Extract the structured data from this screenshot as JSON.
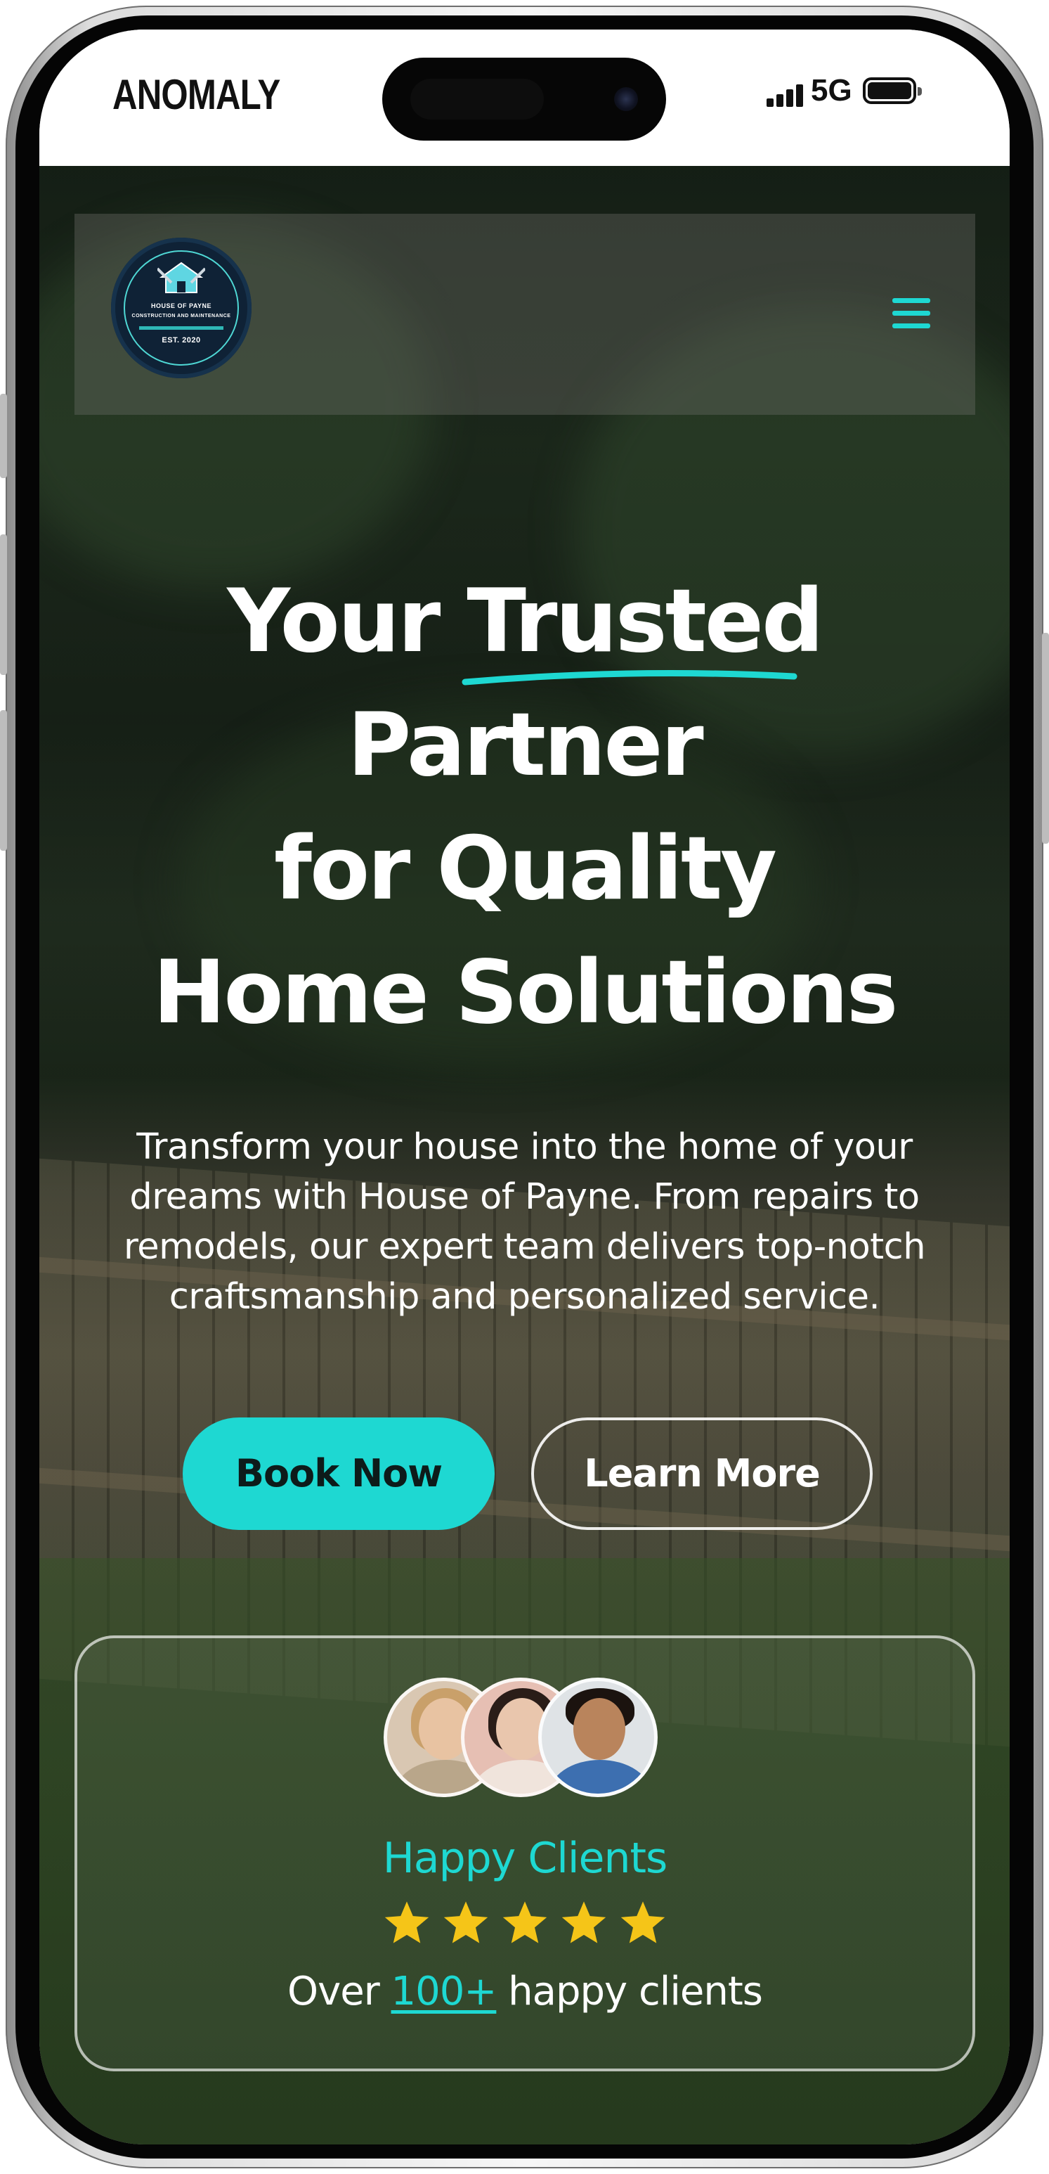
{
  "status_bar": {
    "carrier": "ANOMALY",
    "network": "5G",
    "signal_bars": 4,
    "battery_level": 1.0
  },
  "nav": {
    "logo": {
      "brand_line": "HOUSE OF PAYNE",
      "tagline_line": "CONSTRUCTION AND MAINTENANCE",
      "established": "EST. 2020"
    },
    "menu_icon": "hamburger-menu-icon"
  },
  "hero": {
    "headline_lines": [
      "Your Trusted",
      "Partner",
      "for Quality",
      "Home Solutions"
    ],
    "underline_color": "#1ed8d2",
    "description": "Transform your house into the home of your dreams with House of Payne. From repairs to remodels, our expert team delivers top-notch craftsmanship and personalized service.",
    "primary_button": "Book Now",
    "secondary_button": "Learn More"
  },
  "clients": {
    "title": "Happy Clients",
    "rating": 5,
    "count_prefix": "Over",
    "count_value": "100+",
    "count_suffix": "happy clients"
  },
  "colors": {
    "accent": "#1ed8d2",
    "star": "#f5c518",
    "text_on_dark": "#ffffff"
  }
}
